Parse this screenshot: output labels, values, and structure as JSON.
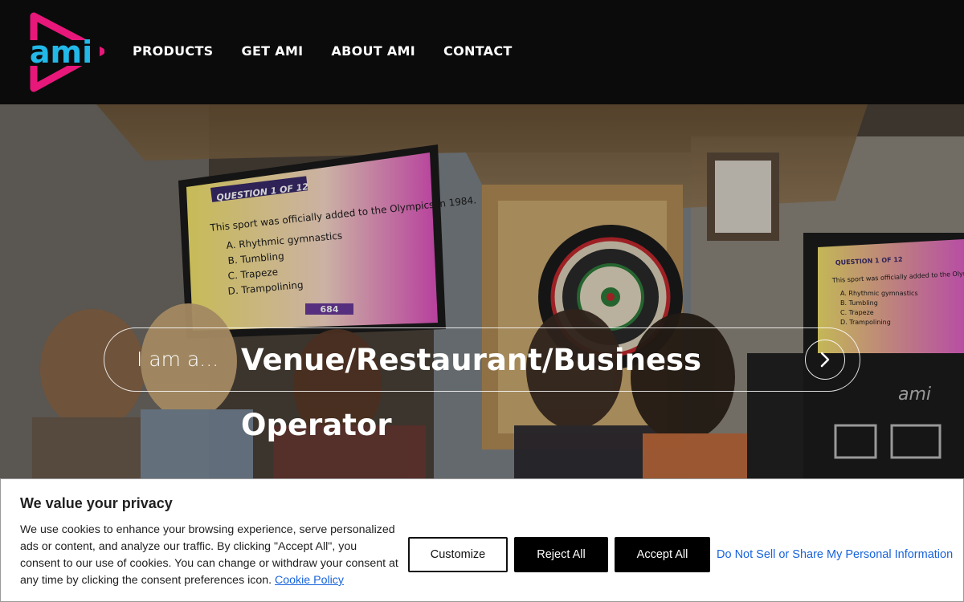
{
  "header": {
    "logo_text": "ami",
    "nav": [
      {
        "label": "PRODUCTS"
      },
      {
        "label": "GET AMI"
      },
      {
        "label": "ABOUT AMI"
      },
      {
        "label": "CONTACT"
      }
    ]
  },
  "hero": {
    "screen_left": {
      "heading": "QUESTION 1 OF 12",
      "question": "This sport was officially added to the Olympics in 1984.",
      "answers": [
        "A. Rhythmic gymnastics",
        "B. Tumbling",
        "C. Trapeze",
        "D. Trampolining"
      ],
      "score": "684"
    },
    "screen_right": {
      "heading": "QUESTION 1 OF 12",
      "question": "This sport was officially added to the Olympics in 1984.",
      "answers": [
        "A. Rhythmic gymnastics",
        "B. Tumbling",
        "C. Trapeze",
        "D. Trampolining"
      ]
    },
    "machine_logo": "ami",
    "selector": {
      "label": "I am a...",
      "value": "Venue/Restaurant/Business",
      "next_icon": "chevron-right-icon"
    },
    "option2": "Operator"
  },
  "cookie": {
    "title": "We value your privacy",
    "text": "We use cookies to enhance your browsing experience, serve personalized ads or content, and analyze our traffic. By clicking \"Accept All\", you consent to our use of cookies. You can change or withdraw your consent at any time by clicking the consent preferences icon.",
    "policy_link": "Cookie Policy",
    "buttons": {
      "customize": "Customize",
      "reject": "Reject All",
      "accept": "Accept All"
    },
    "do_not_sell": "Do Not Sell or Share My Personal Information"
  },
  "colors": {
    "logo_pink": "#e8177a",
    "logo_cyan": "#22b8e8",
    "header_bg": "#0b0b0b",
    "link_blue": "#1863dc"
  }
}
